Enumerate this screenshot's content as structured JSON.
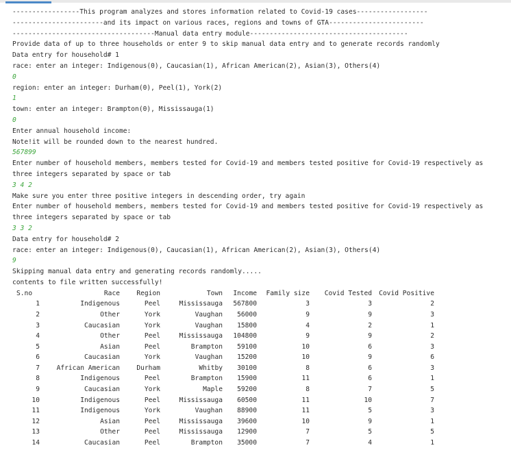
{
  "console": {
    "lines": [
      {
        "type": "output",
        "text": "-----------------This program analyzes and stores information related to Covid-19 cases------------------"
      },
      {
        "type": "output",
        "text": "-----------------------and its impact on various races, regions and towns of GTA------------------------"
      },
      {
        "type": "output",
        "text": "------------------------------------Manual data entry module----------------------------------------"
      },
      {
        "type": "output",
        "text": "Provide data of up to three households or enter 9 to skip manual data entry and to generate records randomly"
      },
      {
        "type": "output",
        "text": "Data entry for household# 1"
      },
      {
        "type": "output",
        "text": "race: enter an integer: Indigenous(0), Caucasian(1), African American(2), Asian(3), Others(4)"
      },
      {
        "type": "input",
        "text": "0"
      },
      {
        "type": "output",
        "text": "region: enter an integer: Durham(0), Peel(1), York(2)"
      },
      {
        "type": "input",
        "text": "1"
      },
      {
        "type": "output",
        "text": "town: enter an integer: Brampton(0), Mississauga(1)"
      },
      {
        "type": "input",
        "text": "0"
      },
      {
        "type": "output",
        "text": "Enter annual household income:"
      },
      {
        "type": "output",
        "text": "Note!it will be rounded down to the nearest hundred."
      },
      {
        "type": "input",
        "text": "567899"
      },
      {
        "type": "output",
        "text": "Enter number of household members, members tested for Covid-19 and members tested positive for Covid-19 respectively as"
      },
      {
        "type": "output",
        "text": "three integers separated by space or tab"
      },
      {
        "type": "input",
        "text": "3 4 2"
      },
      {
        "type": "output",
        "text": "Make sure you enter three positive integers in descending order, try again"
      },
      {
        "type": "output",
        "text": "Enter number of household members, members tested for Covid-19 and members tested positive for Covid-19 respectively as"
      },
      {
        "type": "output",
        "text": "three integers separated by space or tab"
      },
      {
        "type": "input",
        "text": "3 3 2"
      },
      {
        "type": "output",
        "text": "Data entry for household# 2"
      },
      {
        "type": "output",
        "text": "race: enter an integer: Indigenous(0), Caucasian(1), African American(2), Asian(3), Others(4)"
      },
      {
        "type": "input",
        "text": "9"
      },
      {
        "type": "output",
        "text": "Skipping manual data entry and generating records randomly....."
      },
      {
        "type": "output",
        "text": "contents to file written successfully!"
      }
    ]
  },
  "records_table": {
    "headers": [
      "S.no",
      "Race",
      "Region",
      "Town",
      "Income",
      "Family size",
      "Covid Tested",
      "Covid Positive"
    ],
    "rows": [
      [
        "1",
        "Indigenous",
        "Peel",
        "Mississauga",
        "567800",
        "3",
        "3",
        "2"
      ],
      [
        "2",
        "Other",
        "York",
        "Vaughan",
        "56000",
        "9",
        "9",
        "3"
      ],
      [
        "3",
        "Caucasian",
        "York",
        "Vaughan",
        "15800",
        "4",
        "2",
        "1"
      ],
      [
        "4",
        "Other",
        "Peel",
        "Mississauga",
        "104800",
        "9",
        "9",
        "2"
      ],
      [
        "5",
        "Asian",
        "Peel",
        "Brampton",
        "59100",
        "10",
        "6",
        "3"
      ],
      [
        "6",
        "Caucasian",
        "York",
        "Vaughan",
        "15200",
        "10",
        "9",
        "6"
      ],
      [
        "7",
        "African American",
        "Durham",
        "Whitby",
        "30100",
        "8",
        "6",
        "3"
      ],
      [
        "8",
        "Indigenous",
        "Peel",
        "Brampton",
        "15900",
        "11",
        "6",
        "1"
      ],
      [
        "9",
        "Caucasian",
        "York",
        "Maple",
        "59200",
        "8",
        "7",
        "5"
      ],
      [
        "10",
        "Indigenous",
        "Peel",
        "Mississauga",
        "60500",
        "11",
        "10",
        "7"
      ],
      [
        "11",
        "Indigenous",
        "York",
        "Vaughan",
        "88900",
        "11",
        "5",
        "3"
      ],
      [
        "12",
        "Asian",
        "Peel",
        "Mississauga",
        "39600",
        "10",
        "9",
        "1"
      ],
      [
        "13",
        "Other",
        "Peel",
        "Mississauga",
        "12900",
        "7",
        "5",
        "5"
      ],
      [
        "14",
        "Caucasian",
        "Peel",
        "Brampton",
        "35000",
        "7",
        "4",
        "1"
      ]
    ]
  },
  "colors": {
    "text": "#2b2b2b",
    "user_input": "#3aa53a",
    "tab_indicator": "#4a88c7"
  }
}
